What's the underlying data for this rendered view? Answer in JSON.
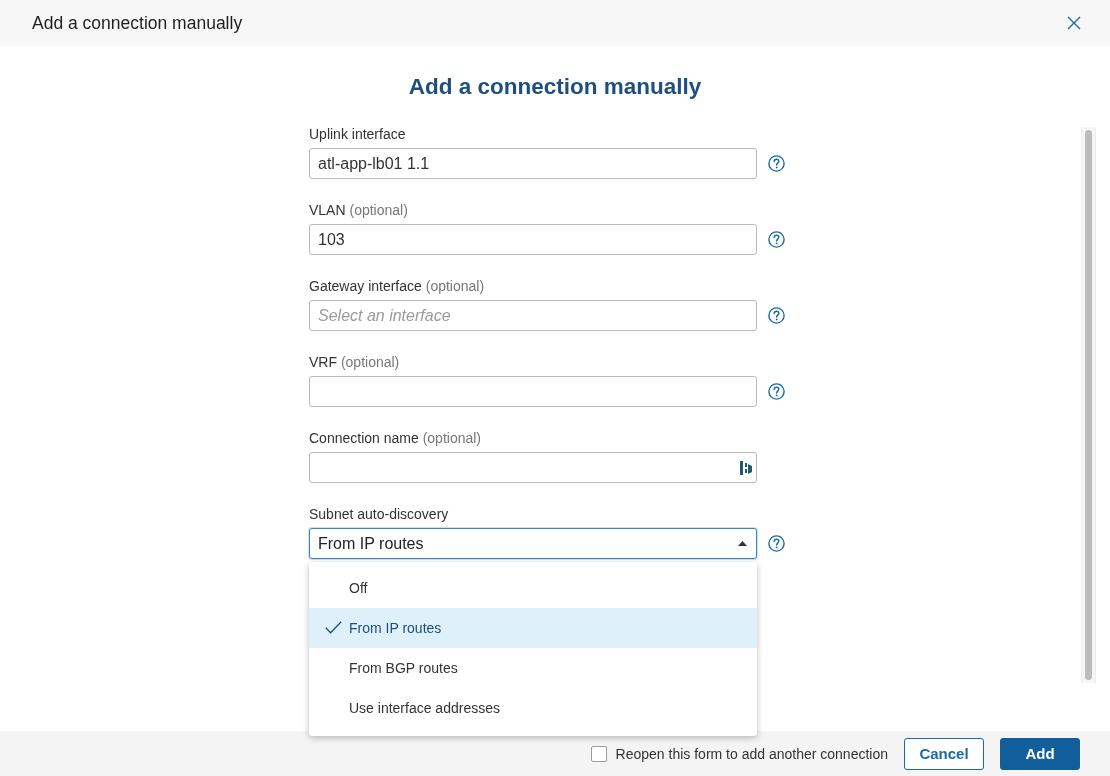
{
  "dialog": {
    "title": "Add a connection manually"
  },
  "heading": "Add a connection manually",
  "fields": [
    {
      "kind": "text",
      "label": "Uplink interface",
      "value": "atl-app-lb01 1.1",
      "help": true
    },
    {
      "kind": "text",
      "label": "VLAN",
      "hint": "(optional)",
      "value": "103",
      "help": true
    },
    {
      "kind": "text",
      "label": "Gateway interface",
      "hint": "(optional)",
      "placeholder": "Select an interface",
      "help": true
    },
    {
      "kind": "text",
      "label": "VRF",
      "hint": "(optional)",
      "help": true
    },
    {
      "kind": "autofill",
      "label": "Connection name",
      "hint": "(optional)",
      "help": false
    },
    {
      "kind": "select",
      "label": "Subnet auto-discovery",
      "value": "From IP routes",
      "expanded": true,
      "help": true,
      "options": [
        {
          "label": "Off",
          "selected": false
        },
        {
          "label": "From IP routes",
          "selected": true
        },
        {
          "label": "From BGP routes",
          "selected": false
        },
        {
          "label": "Use interface addresses",
          "selected": false
        }
      ]
    }
  ],
  "footer": {
    "checkbox": {
      "label": "Reopen this form to add another connection",
      "checked": false
    },
    "buttons": [
      {
        "label": "Cancel",
        "kind": "secondary"
      },
      {
        "label": "Add",
        "kind": "primary"
      }
    ]
  }
}
